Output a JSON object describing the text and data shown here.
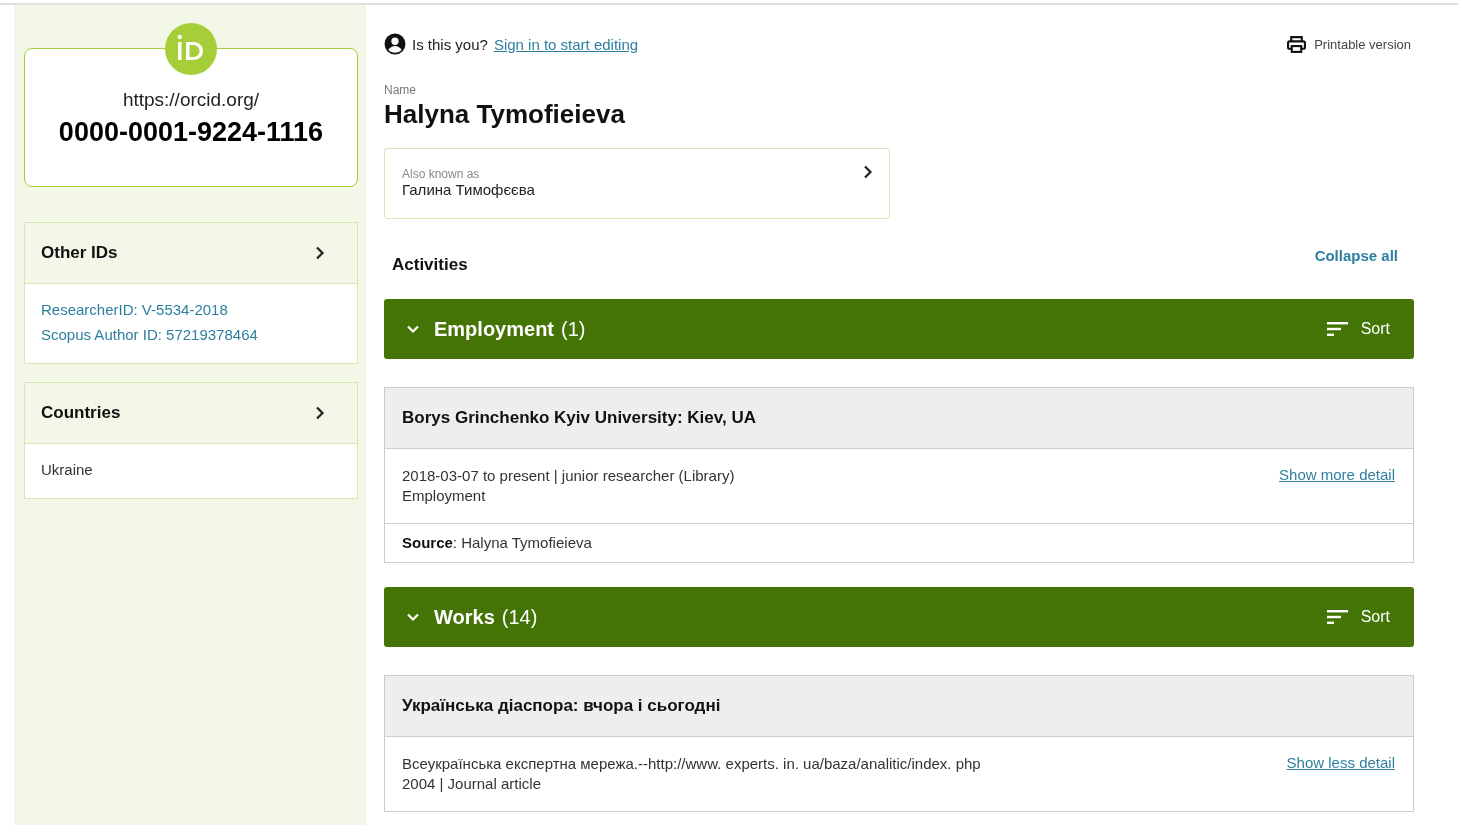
{
  "orcid": {
    "url": "https://orcid.org/",
    "id": "0000-0001-9224-1116"
  },
  "sidebar_panels": [
    {
      "title": "Other IDs",
      "items": [
        {
          "kind": "link",
          "text": "ResearcherID: V-5534-2018"
        },
        {
          "kind": "link",
          "text": "Scopus Author ID: 57219378464"
        }
      ]
    },
    {
      "title": "Countries",
      "items": [
        {
          "kind": "text",
          "text": "Ukraine"
        }
      ]
    }
  ],
  "signin": {
    "prompt": "Is this you?",
    "link": "Sign in to start editing"
  },
  "print_link": "Printable version",
  "name_label": "Name",
  "name": "Halyna Tymofieieva",
  "also_known_as": {
    "label": "Also known as",
    "value": "Галина Тимофєєва"
  },
  "activities": {
    "title": "Activities",
    "collapse": "Collapse all"
  },
  "sections": [
    {
      "title": "Employment",
      "count": "(1)",
      "expanded": true,
      "sort_label": "Sort",
      "items": [
        {
          "title": "Borys Grinchenko Kyiv University: Kiev, UA",
          "lines": [
            "2018-03-07 to present | junior researcher (Library)",
            "Employment"
          ],
          "toggle": "Show more detail",
          "source_label": "Source",
          "source_value": ": Halyna Tymofieieva"
        }
      ]
    },
    {
      "title": "Works",
      "count": "(14)",
      "expanded": true,
      "sort_label": "Sort",
      "items": [
        {
          "title": "Українська діаспора: вчора і сьогодні",
          "lines": [
            "Всеукраїнська експертна мережа.--http://www. experts. in. ua/baza/analitic/index. php",
            "2004 | Journal article"
          ],
          "toggle": "Show less detail"
        }
      ]
    }
  ]
}
